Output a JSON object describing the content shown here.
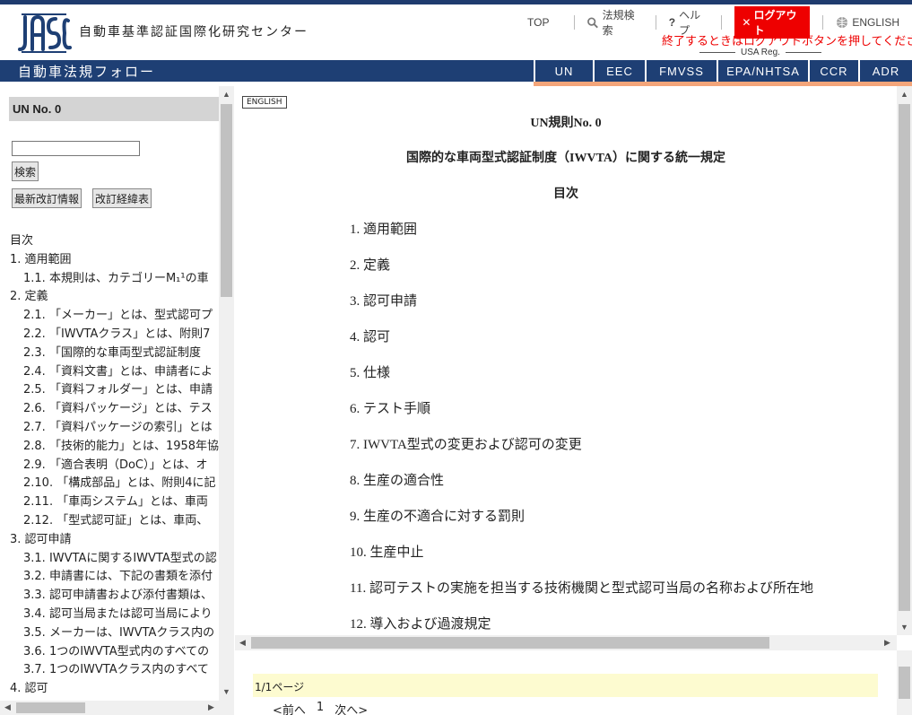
{
  "header": {
    "org_name": "自動車基準認証国際化研究センター",
    "nav": {
      "top": "TOP",
      "search": "法規検索",
      "help": "ヘルプ",
      "logout": "ログアウト",
      "english": "ENGLISH"
    },
    "logout_message": "終了するときはログアウトボタンを押してください",
    "usa_reg": "USA Reg."
  },
  "bluebar": {
    "title": "自動車法規フォロー",
    "tabs": [
      "UN",
      "EEC",
      "FMVSS",
      "EPA/NHTSA",
      "CCR",
      "ADR"
    ]
  },
  "left": {
    "header": "UN No. 0",
    "search_value": "",
    "search_button": "検索",
    "latest_button": "最新改訂情報",
    "history_button": "改訂経緯表",
    "toc": [
      {
        "text": "目次",
        "level": 1
      },
      {
        "text": "1. 適用範囲",
        "level": 1
      },
      {
        "text": "1.1. 本規則は、カテゴリーM₁¹の車",
        "level": 2
      },
      {
        "text": "2. 定義",
        "level": 1
      },
      {
        "text": "2.1. 「メーカー」とは、型式認可プ",
        "level": 2
      },
      {
        "text": "2.2. 「IWVTAクラス」とは、附則7",
        "level": 2
      },
      {
        "text": "2.3. 「国際的な車両型式認証制度",
        "level": 2
      },
      {
        "text": "2.4. 「資料文書」とは、申請者によ",
        "level": 2
      },
      {
        "text": "2.5. 「資料フォルダー」とは、申請",
        "level": 2
      },
      {
        "text": "2.6. 「資料パッケージ」とは、テス",
        "level": 2
      },
      {
        "text": "2.7. 「資料パッケージの索引」とは",
        "level": 2
      },
      {
        "text": "2.8. 「技術的能力」とは、1958年協",
        "level": 2
      },
      {
        "text": "2.9. 「適合表明（DoC）」とは、オ",
        "level": 2
      },
      {
        "text": "2.10. 「構成部品」とは、附則4に記",
        "level": 2
      },
      {
        "text": "2.11. 「車両システム」とは、車両",
        "level": 2
      },
      {
        "text": "2.12. 「型式認可証」とは、車両、",
        "level": 2
      },
      {
        "text": "3. 認可申請",
        "level": 1
      },
      {
        "text": "3.1. IWVTAに関するIWVTA型式の認",
        "level": 2
      },
      {
        "text": "3.2. 申請書には、下記の書類を添付",
        "level": 2
      },
      {
        "text": "3.3. 認可申請書および添付書類は、",
        "level": 2
      },
      {
        "text": "3.4. 認可当局または認可当局により",
        "level": 2
      },
      {
        "text": "3.5. メーカーは、IWVTAクラス内の",
        "level": 2
      },
      {
        "text": "3.6. 1つのIWVTA型式内のすべての",
        "level": 2
      },
      {
        "text": "3.7. 1つのIWVTAクラス内のすべて",
        "level": 2
      },
      {
        "text": "4. 認可",
        "level": 1
      }
    ]
  },
  "doc": {
    "english_button": "ENGLISH",
    "title": "UN規則No. 0",
    "subtitle": "国際的な車両型式認証制度（IWVTA）に関する統一規定",
    "toc_heading": "目次",
    "items": [
      "1. 適用範囲",
      "2. 定義",
      "3. 認可申請",
      "4. 認可",
      "5. 仕様",
      "6. テスト手順",
      "7. IWVTA型式の変更および認可の変更",
      "8. 生産の適合性",
      "9. 生産の不適合に対する罰則",
      "10. 生産中止",
      "11. 認可テストの実施を担当する技術機関と型式認可当局の名称および所在地",
      "12. 導入および過渡規定"
    ]
  },
  "pager": {
    "page_info": "1/1ページ",
    "prev": "<前へ",
    "current": "1",
    "next": "次へ>"
  }
}
